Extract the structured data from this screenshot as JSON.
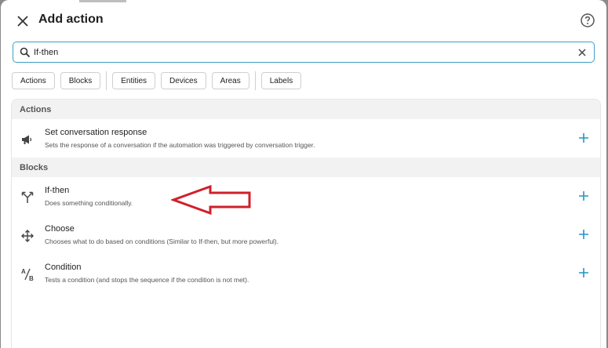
{
  "dialog": {
    "title": "Add action"
  },
  "search": {
    "value": "If-then"
  },
  "filters": {
    "group1": [
      "Actions",
      "Blocks"
    ],
    "group2": [
      "Entities",
      "Devices",
      "Areas"
    ],
    "group3": [
      "Labels"
    ]
  },
  "sections": [
    {
      "title": "Actions",
      "items": [
        {
          "title": "Set conversation response",
          "description": "Sets the response of a conversation if the automation was triggered by conversation trigger.",
          "icon": "megaphone-icon"
        }
      ]
    },
    {
      "title": "Blocks",
      "items": [
        {
          "title": "If-then",
          "description": "Does something conditionally.",
          "icon": "call-split-icon"
        },
        {
          "title": "Choose",
          "description": "Chooses what to do based on conditions (Similar to If-then, but more powerful).",
          "icon": "arrow-decision-icon"
        },
        {
          "title": "Condition",
          "description": "Tests a condition (and stops the sequence if the condition is not met).",
          "icon": "ab-testing-icon"
        }
      ]
    }
  ],
  "colors": {
    "accent": "#03a9f4",
    "annotation": "#d0202a",
    "section_bg": "#f2f2f2"
  }
}
